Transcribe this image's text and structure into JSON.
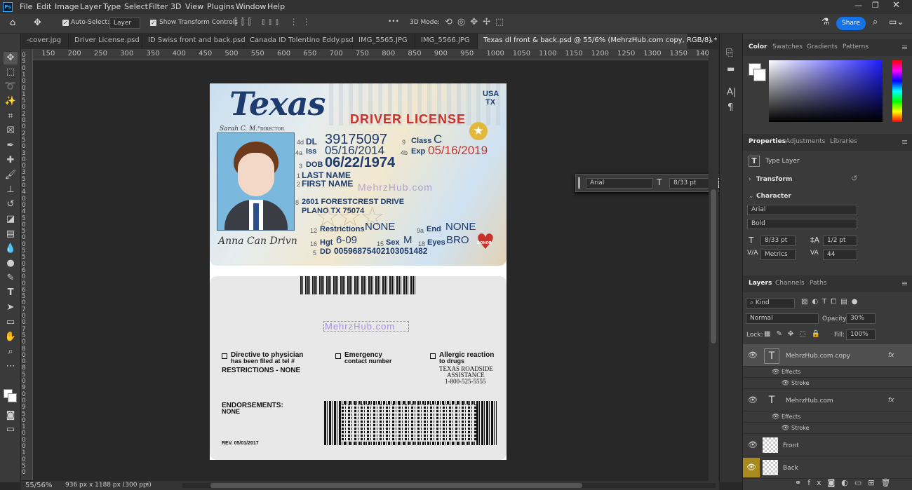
{
  "menu": [
    "File",
    "Edit",
    "Image",
    "Layer",
    "Type",
    "Select",
    "Filter",
    "3D",
    "View",
    "Plugins",
    "Window",
    "Help"
  ],
  "options": {
    "auto_select": "Auto-Select:",
    "layer_value": "Layer",
    "show_transform": "Show Transform Controls",
    "mode_3d": "3D Mode:",
    "share": "Share",
    "dots": "•••"
  },
  "tabs": [
    "-cover.jpg",
    "Driver License.psd",
    "ID Swiss front and back.psd",
    "Canada ID Tolentino Eddy.psd",
    "IMG_5565.JPG",
    "IMG_5566.JPG",
    "Texas dl front & back.psd @ 55/6% (MehrzHub.com copy, RGB/8) *"
  ],
  "ruler_top": [
    "500",
    "150",
    "200",
    "250",
    "300",
    "350",
    "400",
    "450",
    "500",
    "550",
    "600",
    "650",
    "700",
    "750",
    "800",
    "850",
    "900",
    "950",
    "1000",
    "1050",
    "1100",
    "1150",
    "1200",
    "1250",
    "1300",
    "1350",
    "1400",
    "1450",
    "1500"
  ],
  "ruler_left": [
    "0",
    "5",
    "0",
    "1",
    "0",
    "0",
    "1",
    "5",
    "0",
    "2",
    "0",
    "0",
    "2",
    "5",
    "0",
    "3",
    "0",
    "0",
    "3",
    "5",
    "0",
    "4",
    "0",
    "0",
    "4",
    "5",
    "0",
    "5",
    "0",
    "0",
    "5",
    "5",
    "0",
    "6",
    "0",
    "0",
    "6",
    "5",
    "0",
    "7",
    "0",
    "0",
    "7",
    "5",
    "0",
    "8",
    "0",
    "0",
    "8",
    "5",
    "0",
    "9",
    "0",
    "0",
    "9",
    "5",
    "0",
    "1",
    "0",
    "0",
    "0",
    "1",
    "0",
    "5",
    "0"
  ],
  "status": {
    "zoom": "55/56%",
    "doc": "936 px x 1188 px (300 ppi)"
  },
  "float_bar": {
    "font": "Arial",
    "size": "8/33 pt",
    "help": "?"
  },
  "card_front": {
    "state": "Texas",
    "title": "DRIVER LICENSE",
    "usa": "USA",
    "tx": "TX",
    "director": "DIRECTOR",
    "dl_n": "4d",
    "dl_l": "DL",
    "dl_v": "39175097",
    "class_n": "9",
    "class_l": "Class",
    "class_v": "C",
    "iss_n": "4a",
    "iss_l": "Iss",
    "iss_v": "05/16/2014",
    "exp_n": "4b",
    "exp_l": "Exp",
    "exp_v": "05/16/2019",
    "dob_n": "3",
    "dob_l": "DOB",
    "dob_v": "06/22/1974",
    "last": "LAST NAME",
    "first": "FIRST NAME",
    "n1": "1",
    "n2": "2",
    "watermark": "MehrzHub.com",
    "addr_n": "8",
    "addr1": "2601 FORESTCREST DRIVE",
    "addr2": "PLANO TX 75074",
    "res_n": "12",
    "res_l": "Restrictions",
    "res_v": "NONE",
    "end_n": "9a",
    "end_l": "End",
    "end_v": "NONE",
    "hgt_n": "16",
    "hgt_l": "Hgt",
    "hgt_v": "6-09",
    "sex_n": "15",
    "sex_l": "Sex",
    "sex_v": "M",
    "eyes_n": "18",
    "eyes_l": "Eyes",
    "eyes_v": "BRO",
    "dd_n": "5",
    "dd_l": "DD",
    "dd_v": "00596875402103051482",
    "donor": "DONOR",
    "signature": "Anna Can Drivn"
  },
  "card_back": {
    "watermark": "MehrzHub.com",
    "check1a": "Directive to physician",
    "check1b": "has been filed at tel #",
    "check2a": "Emergency",
    "check2b": "contact number",
    "check3a": "Allergic reaction",
    "check3b": "to drugs",
    "restrictions": "RESTRICTIONS -  NONE",
    "roadside1": "TEXAS ROADSIDE",
    "roadside2": "ASSISTANCE",
    "roadside3": "1-800-525-5555",
    "endorse1": "ENDORSEMENTS:",
    "endorse2": "NONE",
    "rev": "REV. 05/01/2017"
  },
  "color_panel": {
    "tabs": [
      "Color",
      "Swatches",
      "Gradients",
      "Patterns"
    ]
  },
  "props_panel": {
    "tabs": [
      "Properties",
      "Adjustments",
      "Libraries"
    ],
    "type_layer": "Type Layer",
    "transform": "Transform",
    "character": "Character",
    "font": "Arial",
    "style": "Bold",
    "size": "8/33 pt",
    "leading": "1/2 pt",
    "kerning": "Metrics",
    "tracking": "44"
  },
  "layers_panel": {
    "tabs": [
      "Layers",
      "Channels",
      "Paths"
    ],
    "kind": "Kind",
    "blend": "Normal",
    "opacity_l": "Opacity:",
    "opacity_v": "30%",
    "lock": "Lock:",
    "fill_l": "Fill:",
    "fill_v": "100%",
    "layers": [
      {
        "name": "MehrzHub.com copy",
        "fx": "fx"
      },
      {
        "name": "Effects"
      },
      {
        "name": "Stroke"
      },
      {
        "name": "MehrzHub.com",
        "fx": "fx"
      },
      {
        "name": "Effects"
      },
      {
        "name": "Stroke"
      },
      {
        "name": "Front"
      },
      {
        "name": "Back"
      }
    ]
  },
  "colors": {
    "accent": "#1473e6",
    "dl_blue": "#1d3b6e",
    "dl_red": "#c8312c"
  }
}
